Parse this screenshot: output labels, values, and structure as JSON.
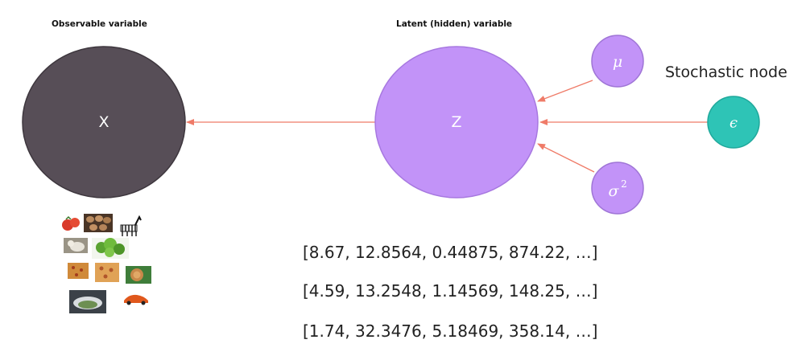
{
  "headers": {
    "observable": "Observable variable",
    "latent": "Latent (hidden) variable"
  },
  "nodes": {
    "x": {
      "label": "X",
      "color": "#574e57"
    },
    "z": {
      "label": "Z",
      "color": "#c293f8"
    },
    "mu": {
      "label": "μ",
      "color": "#c293f8"
    },
    "sigma": {
      "label": "σ",
      "superscript": "2",
      "color": "#c293f8"
    },
    "epsilon": {
      "label": "ϵ",
      "color": "#2ec4b6"
    }
  },
  "stochastic_label": "Stochastic node",
  "arrow_color": "#ef7b68",
  "vectors": [
    "[8.67, 12.8564, 0.44875, 874.22, …]",
    "[4.59, 13.2548, 1.14569, 148.25, …]",
    "[1.74, 32.3476, 5.18469, 358.14, …]"
  ],
  "image_thumbnails": [
    "tomato",
    "eggs",
    "zebra",
    "cat",
    "lettuce",
    "pizza",
    "bread",
    "lion",
    "stadium",
    "sports-car"
  ]
}
